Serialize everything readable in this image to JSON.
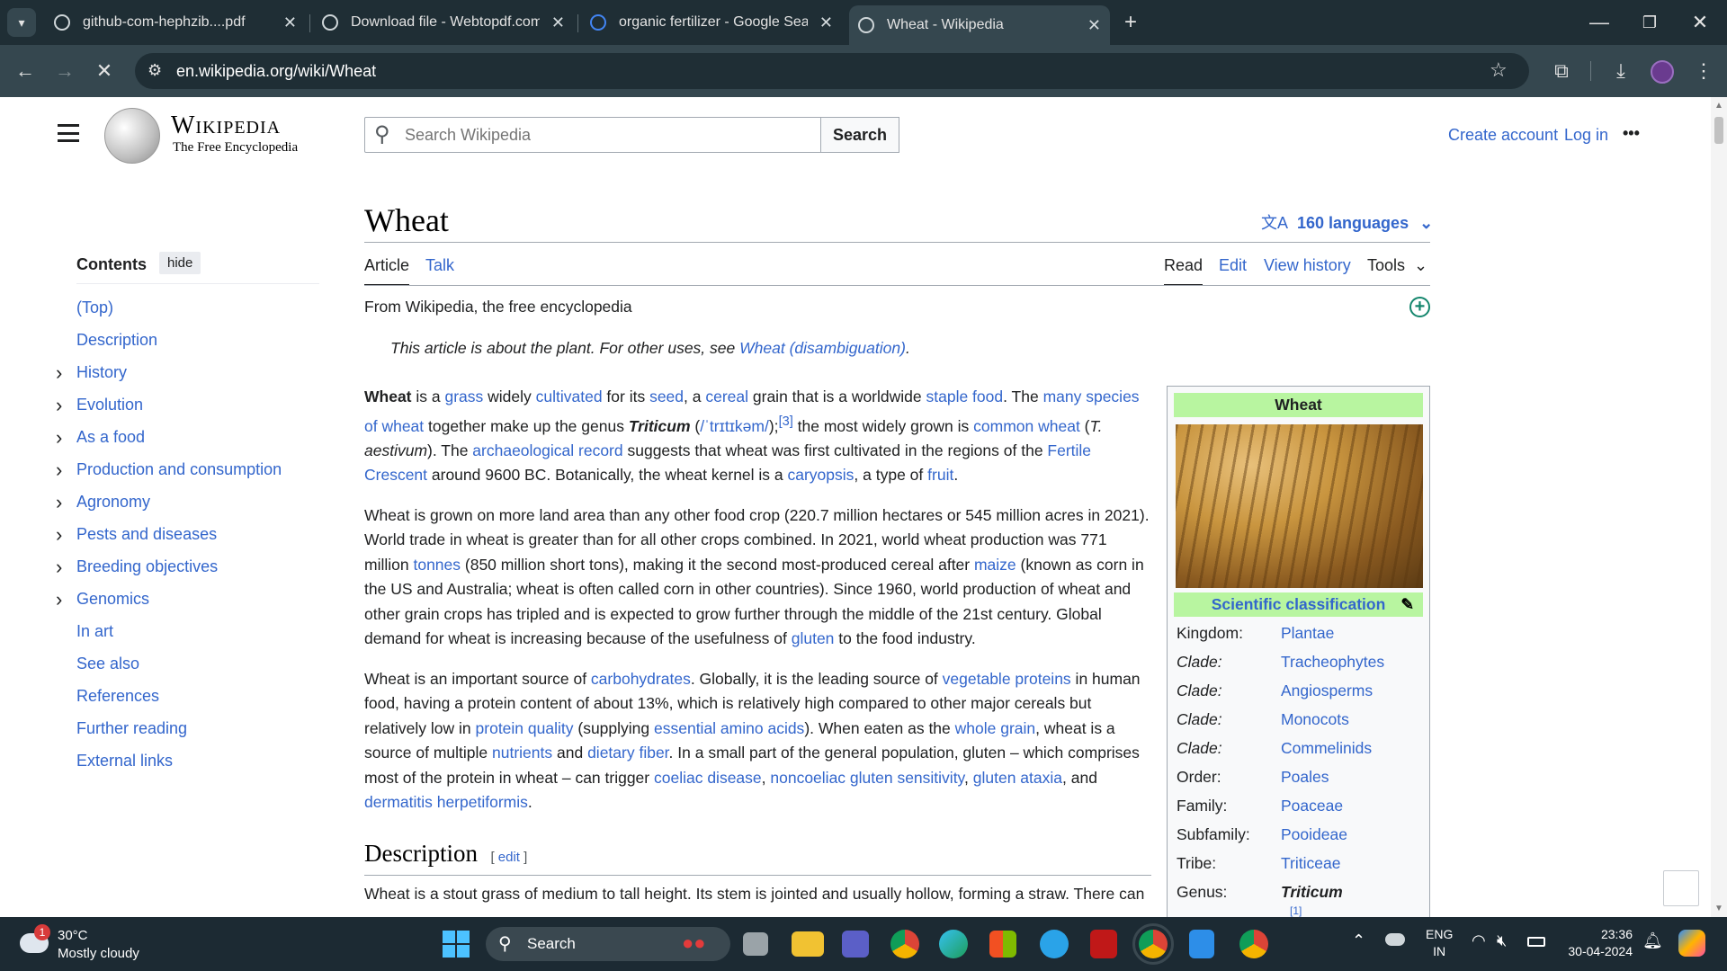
{
  "browser": {
    "tabs": [
      {
        "title": "github-com-hephzib....pdf",
        "active": false
      },
      {
        "title": "Download file - Webtopdf.com",
        "active": false
      },
      {
        "title": "organic fertilizer - Google Search",
        "active": false
      },
      {
        "title": "Wheat - Wikipedia",
        "active": true
      }
    ],
    "url": "en.wikipedia.org/wiki/Wheat"
  },
  "header": {
    "logo_title": "Wikipedia",
    "logo_subtitle": "The Free Encyclopedia",
    "search_placeholder": "Search Wikipedia",
    "search_button": "Search",
    "create_account": "Create account",
    "log_in": "Log in",
    "more": "•••"
  },
  "toc": {
    "title": "Contents",
    "hide": "hide",
    "items": [
      {
        "label": "(Top)",
        "expandable": false
      },
      {
        "label": "Description",
        "expandable": false
      },
      {
        "label": "History",
        "expandable": true
      },
      {
        "label": "Evolution",
        "expandable": true
      },
      {
        "label": "As a food",
        "expandable": true
      },
      {
        "label": "Production and consumption",
        "expandable": true
      },
      {
        "label": "Agronomy",
        "expandable": true
      },
      {
        "label": "Pests and diseases",
        "expandable": true
      },
      {
        "label": "Breeding objectives",
        "expandable": true
      },
      {
        "label": "Genomics",
        "expandable": true
      },
      {
        "label": "In art",
        "expandable": false
      },
      {
        "label": "See also",
        "expandable": false
      },
      {
        "label": "References",
        "expandable": false
      },
      {
        "label": "Further reading",
        "expandable": false
      },
      {
        "label": "External links",
        "expandable": false
      }
    ]
  },
  "article": {
    "title": "Wheat",
    "languages": "160 languages",
    "tabs_left": [
      "Article",
      "Talk"
    ],
    "tabs_right": [
      "Read",
      "Edit",
      "View history",
      "Tools"
    ],
    "from": "From Wikipedia, the free encyclopedia",
    "hatnote_prefix": "This article is about the plant. For other uses, see ",
    "hatnote_link": "Wheat (disambiguation)",
    "hatnote_suffix": ".",
    "section_description": "Description",
    "edit": "edit",
    "desc_first_line": "Wheat is a stout grass of medium to tall height. Its stem is jointed and usually hollow, forming a straw. There can"
  },
  "infobox": {
    "title": "Wheat",
    "sci_class": "Scientific classification",
    "rows": [
      {
        "rank": "Kingdom:",
        "value": "Plantae",
        "italic_rank": false
      },
      {
        "rank": "Clade:",
        "value": "Tracheophytes",
        "italic_rank": true
      },
      {
        "rank": "Clade:",
        "value": "Angiosperms",
        "italic_rank": true
      },
      {
        "rank": "Clade:",
        "value": "Monocots",
        "italic_rank": true
      },
      {
        "rank": "Clade:",
        "value": "Commelinids",
        "italic_rank": true
      },
      {
        "rank": "Order:",
        "value": "Poales",
        "italic_rank": false
      },
      {
        "rank": "Family:",
        "value": "Poaceae",
        "italic_rank": false
      },
      {
        "rank": "Subfamily:",
        "value": "Pooideae",
        "italic_rank": false
      },
      {
        "rank": "Tribe:",
        "value": "Triticeae",
        "italic_rank": false
      },
      {
        "rank": "Genus:",
        "value": "Triticum",
        "italic_rank": false
      }
    ],
    "footnote": "[1]"
  },
  "taskbar": {
    "temp": "30°C",
    "weather": "Mostly cloudy",
    "badge": "1",
    "search": "Search",
    "lang1": "ENG",
    "lang2": "IN",
    "time": "23:36",
    "date": "30-04-2024"
  }
}
